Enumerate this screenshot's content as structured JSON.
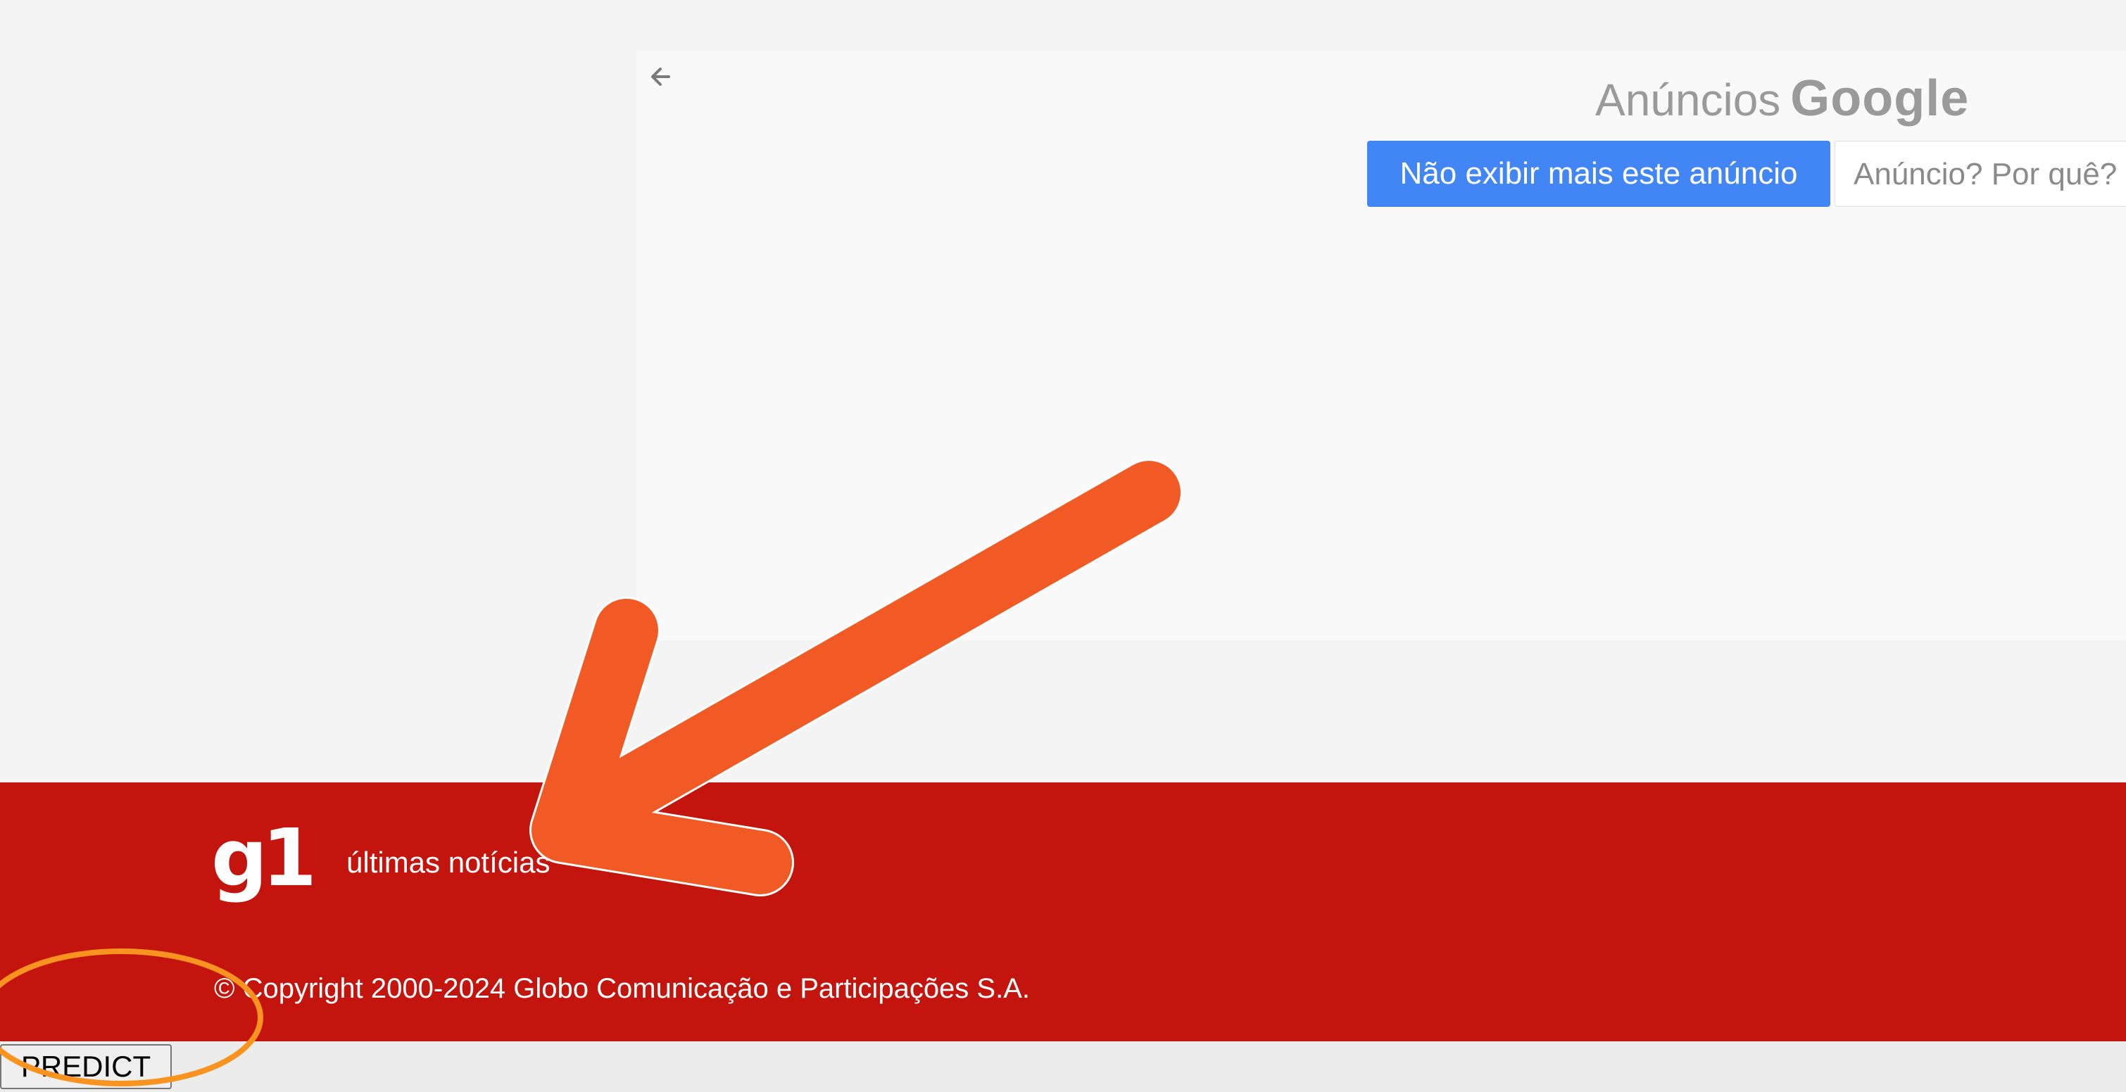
{
  "ad": {
    "brand_prefix": "Anúncios",
    "brand_google": "Google",
    "hide_ad_label": "Não exibir mais este anúncio",
    "why_ad_label": "Anúncio? Por quê?",
    "back_icon": "arrow-left-icon"
  },
  "footer": {
    "logo_text": "g1",
    "latest_news_label": "últimas notícias",
    "copyright": "© Copyright 2000-2024 Globo Comunicação e Participações S.A."
  },
  "bottom": {
    "predict_label": "PREDICT"
  },
  "colors": {
    "page_background": "#f4f4f4",
    "ad_background": "#f9f9f9",
    "google_blue": "#4285f4",
    "footer_red": "#c3150d",
    "annotation_arrow": "#f15a24",
    "annotation_circle": "#f7931e"
  },
  "annotations": {
    "arrow_icon": "pointer-arrow-icon",
    "circle_icon": "highlight-circle-icon"
  }
}
